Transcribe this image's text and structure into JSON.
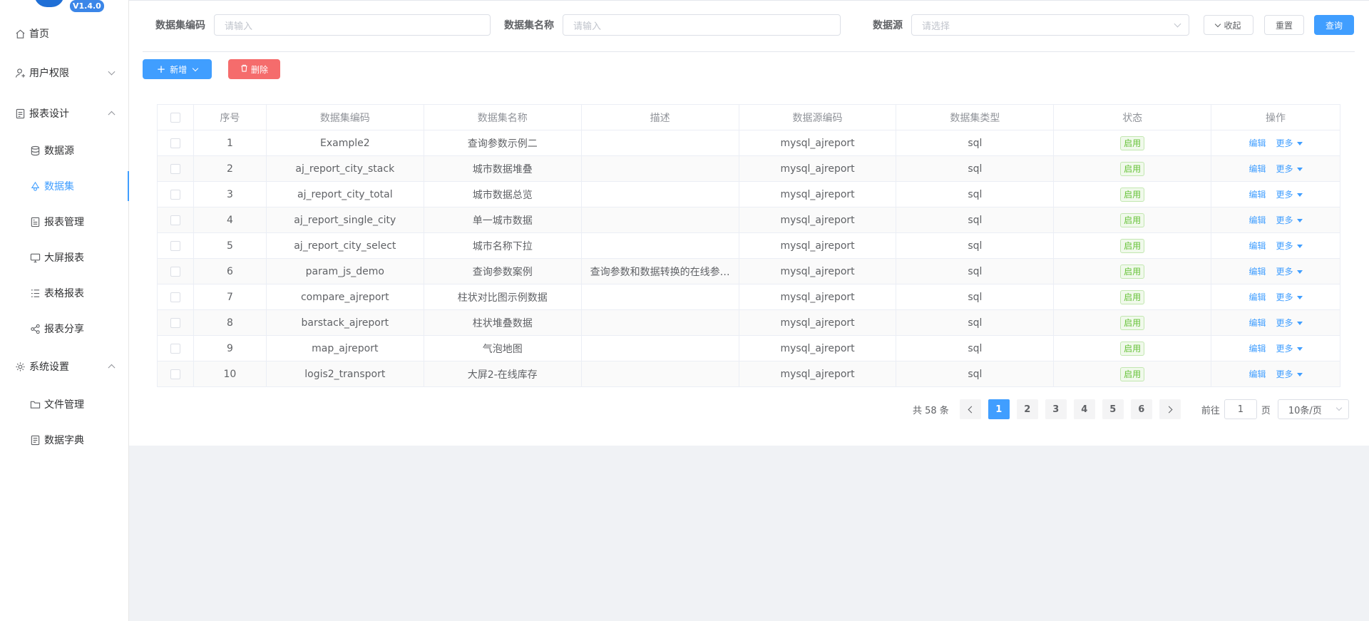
{
  "app": {
    "version": "V1.4.0"
  },
  "sidebar": {
    "items": [
      {
        "label": "首页",
        "icon": "home-icon"
      },
      {
        "label": "用户权限",
        "icon": "user-icon",
        "expanded": false
      },
      {
        "label": "报表设计",
        "icon": "report-design-icon",
        "expanded": true
      },
      {
        "label": "数据源",
        "icon": "database-icon"
      },
      {
        "label": "数据集",
        "icon": "dataset-icon",
        "active": true
      },
      {
        "label": "报表管理",
        "icon": "report-manage-icon"
      },
      {
        "label": "大屏报表",
        "icon": "monitor-icon"
      },
      {
        "label": "表格报表",
        "icon": "table-list-icon"
      },
      {
        "label": "报表分享",
        "icon": "share-icon"
      },
      {
        "label": "系统设置",
        "icon": "gear-icon",
        "expanded": true
      },
      {
        "label": "文件管理",
        "icon": "folder-icon"
      },
      {
        "label": "数据字典",
        "icon": "dictionary-icon"
      }
    ]
  },
  "search": {
    "code_label": "数据集编码",
    "code_placeholder": "请输入",
    "name_label": "数据集名称",
    "name_placeholder": "请输入",
    "source_label": "数据源",
    "source_placeholder": "请选择",
    "collapse_label": "收起",
    "reset_label": "重置",
    "query_label": "查询"
  },
  "toolbar": {
    "add_label": "新增",
    "delete_label": "删除"
  },
  "table": {
    "headers": [
      "序号",
      "数据集编码",
      "数据集名称",
      "描述",
      "数据源编码",
      "数据集类型",
      "状态",
      "操作"
    ],
    "rows": [
      {
        "no": "1",
        "code": "Example2",
        "name": "查询参数示例二",
        "desc": "",
        "source": "mysql_ajreport",
        "type": "sql",
        "status": "启用"
      },
      {
        "no": "2",
        "code": "aj_report_city_stack",
        "name": "城市数据堆叠",
        "desc": "",
        "source": "mysql_ajreport",
        "type": "sql",
        "status": "启用"
      },
      {
        "no": "3",
        "code": "aj_report_city_total",
        "name": "城市数据总览",
        "desc": "",
        "source": "mysql_ajreport",
        "type": "sql",
        "status": "启用"
      },
      {
        "no": "4",
        "code": "aj_report_single_city",
        "name": "单一城市数据",
        "desc": "",
        "source": "mysql_ajreport",
        "type": "sql",
        "status": "启用"
      },
      {
        "no": "5",
        "code": "aj_report_city_select",
        "name": "城市名称下拉",
        "desc": "",
        "source": "mysql_ajreport",
        "type": "sql",
        "status": "启用"
      },
      {
        "no": "6",
        "code": "param_js_demo",
        "name": "查询参数案例",
        "desc": "查询参数和数据转换的在线参…",
        "source": "mysql_ajreport",
        "type": "sql",
        "status": "启用"
      },
      {
        "no": "7",
        "code": "compare_ajreport",
        "name": "柱状对比图示例数据",
        "desc": "",
        "source": "mysql_ajreport",
        "type": "sql",
        "status": "启用"
      },
      {
        "no": "8",
        "code": "barstack_ajreport",
        "name": "柱状堆叠数据",
        "desc": "",
        "source": "mysql_ajreport",
        "type": "sql",
        "status": "启用"
      },
      {
        "no": "9",
        "code": "map_ajreport",
        "name": "气泡地图",
        "desc": "",
        "source": "mysql_ajreport",
        "type": "sql",
        "status": "启用"
      },
      {
        "no": "10",
        "code": "logis2_transport",
        "name": "大屏2-在线库存",
        "desc": "",
        "source": "mysql_ajreport",
        "type": "sql",
        "status": "启用"
      }
    ],
    "edit_label": "编辑",
    "more_label": "更多"
  },
  "pagination": {
    "total_text": "共 58 条",
    "pages": [
      "1",
      "2",
      "3",
      "4",
      "5",
      "6"
    ],
    "current": "1",
    "goto_label": "前往",
    "goto_value": "1",
    "page_unit": "页",
    "page_size": "10条/页"
  },
  "colors": {
    "primary": "#409eff",
    "danger": "#f56c6c",
    "success": "#67c23a",
    "logo": "#1f6fd6"
  }
}
